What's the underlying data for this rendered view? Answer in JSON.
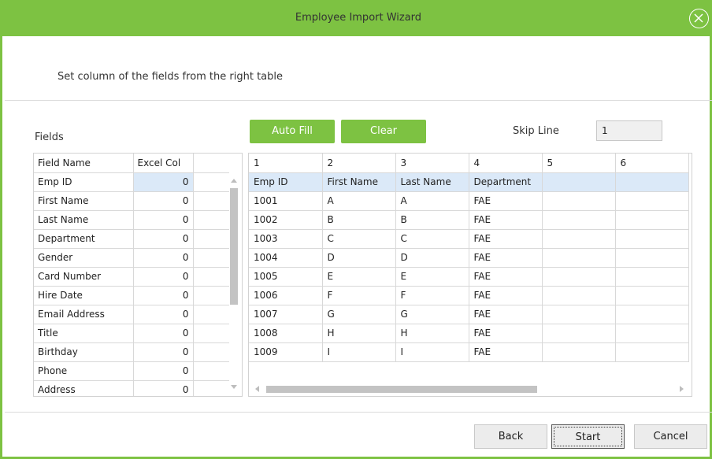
{
  "window": {
    "title": "Employee Import Wizard"
  },
  "instruction": "Set column of the fields from the right table",
  "fields_panel": {
    "label": "Fields",
    "headers": [
      "Field Name",
      "Excel Col"
    ],
    "rows": [
      {
        "name": "Emp ID",
        "col": "0"
      },
      {
        "name": "First Name",
        "col": "0"
      },
      {
        "name": "Last Name",
        "col": "0"
      },
      {
        "name": "Department",
        "col": "0"
      },
      {
        "name": "Gender",
        "col": "0"
      },
      {
        "name": "Card Number",
        "col": "0"
      },
      {
        "name": "Hire Date",
        "col": "0"
      },
      {
        "name": "Email Address",
        "col": "0"
      },
      {
        "name": "Title",
        "col": "0"
      },
      {
        "name": "Birthday",
        "col": "0"
      },
      {
        "name": "Phone",
        "col": "0"
      },
      {
        "name": "Address",
        "col": "0"
      }
    ]
  },
  "toolbar": {
    "auto_fill_label": "Auto Fill",
    "clear_label": "Clear",
    "skip_line_label": "Skip Line",
    "skip_line_value": "1"
  },
  "data_table": {
    "rows": [
      [
        "1",
        "2",
        "3",
        "4",
        "5",
        "6"
      ],
      [
        "Emp ID",
        "First Name",
        "Last Name",
        "Department",
        "",
        ""
      ],
      [
        "1001",
        "A",
        "A",
        "FAE",
        "",
        ""
      ],
      [
        "1002",
        "B",
        "B",
        "FAE",
        "",
        ""
      ],
      [
        "1003",
        "C",
        "C",
        "FAE",
        "",
        ""
      ],
      [
        "1004",
        "D",
        "D",
        "FAE",
        "",
        ""
      ],
      [
        "1005",
        "E",
        "E",
        "FAE",
        "",
        ""
      ],
      [
        "1006",
        "F",
        "F",
        "FAE",
        "",
        ""
      ],
      [
        "1007",
        "G",
        "G",
        "FAE",
        "",
        ""
      ],
      [
        "1008",
        "H",
        "H",
        "FAE",
        "",
        ""
      ],
      [
        "1009",
        "I",
        "I",
        "FAE",
        "",
        ""
      ]
    ]
  },
  "footer": {
    "back_label": "Back",
    "start_label": "Start",
    "cancel_label": "Cancel"
  },
  "colors": {
    "accent": "#7dc242",
    "selection": "#dbe9f8"
  },
  "icons": {
    "close": "close-circle-icon"
  }
}
